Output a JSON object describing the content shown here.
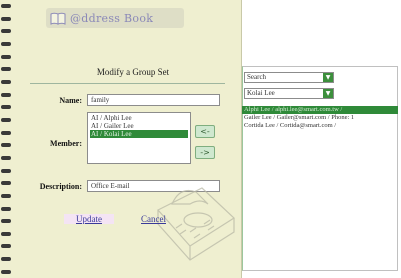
{
  "brand": {
    "title": "@ddress Book"
  },
  "form": {
    "title": "Modify a Group Set",
    "name_label": "Name:",
    "name_value": "family",
    "member_label": "Member:",
    "members": [
      "AI / Alphi Lee",
      "AI / Gailer Lee",
      "AI / Kolai Lee"
    ],
    "selected_member": 2,
    "add_arrow": "<-",
    "remove_arrow": "->",
    "description_label": "Description:",
    "description_value": "Office E-mail",
    "update_label": "Update",
    "cancel_label": "Cancel"
  },
  "picker": {
    "filter_value": "Search",
    "group_value": "Kolai Lee",
    "contacts": [
      "Alphi Lee / alphi.lee@smart.com.tw /",
      "Gailer Lee / Gailer@smart.com / Phone: 1",
      "Cortida Lee / Cortida@smart.com /"
    ],
    "selected_contact": 0
  },
  "colors": {
    "accent": "#2f8a39",
    "book_background": "#efefd0",
    "brand_text": "#8a88b8",
    "link": "#3a3a9a"
  }
}
